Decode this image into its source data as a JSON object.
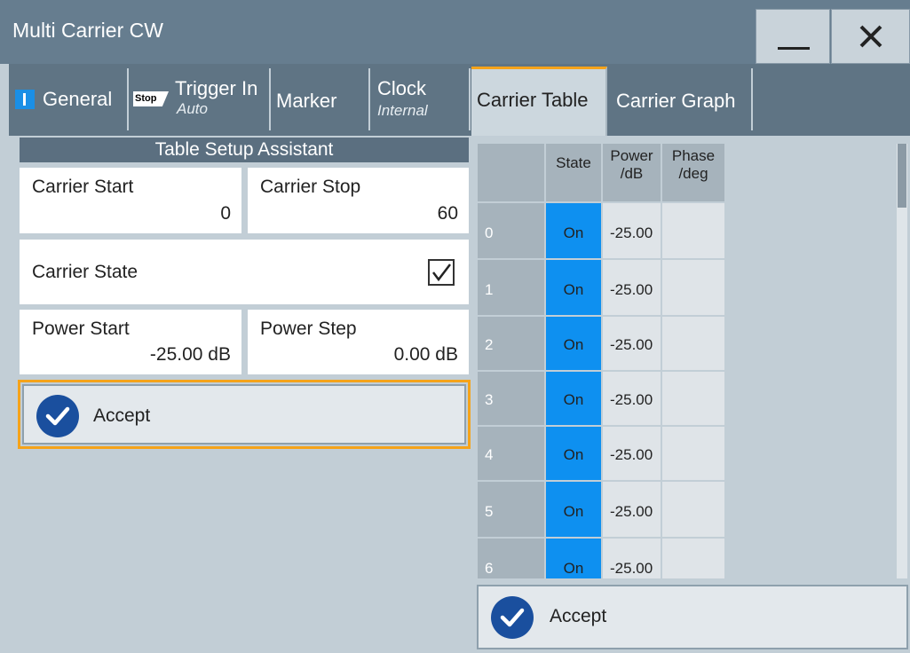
{
  "window": {
    "title": "Multi Carrier CW"
  },
  "tabs": {
    "general": {
      "label": "General"
    },
    "trigger": {
      "label": "Trigger In",
      "sub": "Auto",
      "icon_text": "Stop"
    },
    "marker": {
      "label": "Marker"
    },
    "clock": {
      "label": "Clock",
      "sub": "Internal"
    },
    "carrier_table": {
      "label": "Carrier Table"
    },
    "carrier_graph": {
      "label": "Carrier Graph"
    }
  },
  "setup": {
    "header": "Table Setup Assistant",
    "carrier_start": {
      "label": "Carrier Start",
      "value": "0"
    },
    "carrier_stop": {
      "label": "Carrier Stop",
      "value": "60"
    },
    "carrier_state": {
      "label": "Carrier State",
      "checked": true
    },
    "power_start": {
      "label": "Power Start",
      "value": "-25.00 dB"
    },
    "power_step": {
      "label": "Power Step",
      "value": "0.00 dB"
    },
    "accept_label": "Accept"
  },
  "table": {
    "headers": {
      "state": "State",
      "power": "Power\n/dB",
      "phase": "Phase\n/deg"
    },
    "rows": [
      {
        "index": "0",
        "state": "On",
        "power": "-25.00"
      },
      {
        "index": "1",
        "state": "On",
        "power": "-25.00"
      },
      {
        "index": "2",
        "state": "On",
        "power": "-25.00"
      },
      {
        "index": "3",
        "state": "On",
        "power": "-25.00"
      },
      {
        "index": "4",
        "state": "On",
        "power": "-25.00"
      },
      {
        "index": "5",
        "state": "On",
        "power": "-25.00"
      },
      {
        "index": "6",
        "state": "On",
        "power": "-25.00"
      }
    ],
    "accept_label": "Accept"
  },
  "colors": {
    "accent_orange": "#f5a31a",
    "state_on_blue": "#0e90f0",
    "check_circle": "#1a4f9e"
  }
}
